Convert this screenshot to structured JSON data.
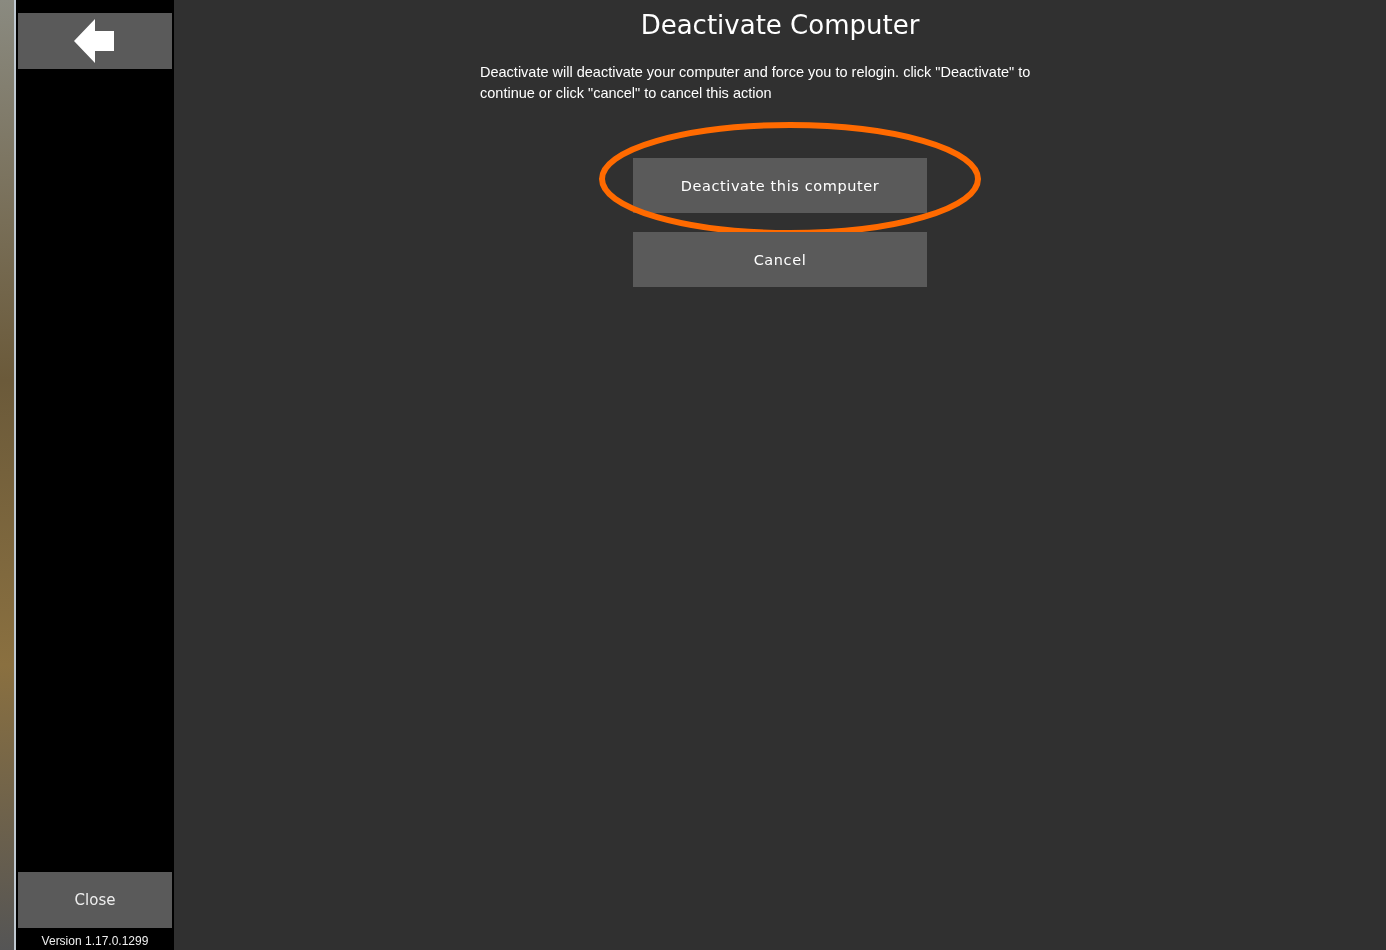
{
  "sidebar": {
    "close_button": {
      "label": "Close"
    },
    "version": "Version 1.17.0.1299"
  },
  "dialog": {
    "title": "Deactivate Computer",
    "message": "Deactivate will deactivate your computer and force you to relogin. click \"Deactivate\" to continue or click \"cancel\" to cancel this action",
    "buttons": [
      {
        "label": "Deactivate this computer",
        "highlighted": true
      },
      {
        "label": "Cancel",
        "highlighted": false
      }
    ]
  }
}
